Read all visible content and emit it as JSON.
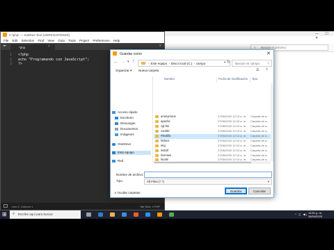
{
  "browser": {
    "window_controls": "— ☐ ✕",
    "search_placeholder": "Buscar el próximo"
  },
  "sublime": {
    "title": "C:\\php\\ — Sublime Text (UNREGISTERED)",
    "menu": [
      "File",
      "Edit",
      "Selection",
      "Find",
      "View",
      "Goto",
      "Tools",
      "Project",
      "Preferences",
      "Help"
    ],
    "tab_label": "*php",
    "line_numbers": "1\n2\n3",
    "code": "<?php\necho \"Programando con JavaScript\";\n?>",
    "status_left": "Line 1, Column 1",
    "status_right": "Tab Size: 4     PHP"
  },
  "dialog": {
    "title": "Guardar como",
    "close_glyph": "✕",
    "path": [
      "Este equipo",
      "Disco local (C:)",
      "campo"
    ],
    "search_placeholder": "Buscar en campo",
    "organizar_label": "Organizar ▾",
    "nueva_carpeta_label": "Nueva carpeta",
    "nav_items": [
      {
        "label": "Acceso rápido",
        "icon": "star-icon"
      },
      {
        "label": "Escritorio",
        "icon": "desktop-icon"
      },
      {
        "label": "Descargas",
        "icon": "download-icon"
      },
      {
        "label": "Documentos",
        "icon": "documents-icon"
      },
      {
        "label": "Imágenes",
        "icon": "pictures-icon"
      },
      {
        "label": "OneDrive",
        "icon": "cloud-icon"
      },
      {
        "label": "Este equipo",
        "icon": "computer-icon"
      },
      {
        "label": "Red",
        "icon": "network-icon"
      }
    ],
    "columns": [
      "Nombre",
      "Fecha de modificación",
      "Tipo"
    ],
    "files": [
      {
        "name": "anonymous",
        "date": "27/06/2020 12:13 a. m.",
        "type": "Carpeta de a..."
      },
      {
        "name": "apache",
        "date": "27/06/2020 12:15 a. m.",
        "type": "Carpeta de a..."
      },
      {
        "name": "cgi-bin",
        "date": "27/06/2020 12:13 a. m.",
        "type": "Carpeta de a..."
      },
      {
        "name": "contrib",
        "date": "27/06/2020 12:13 a. m.",
        "type": "Carpeta de a..."
      },
      {
        "name": "FileZilla",
        "date": "27/06/2020 12:13 a. m.",
        "type": "Carpeta de a..."
      },
      {
        "name": "htdocs",
        "date": "27/06/2020 12:13 a. m.",
        "type": "Carpeta de a..."
      },
      {
        "name": "img",
        "date": "27/06/2020 12:13 a. m.",
        "type": "Carpeta de a..."
      },
      {
        "name": "install",
        "date": "27/06/2020 12:13 a. m.",
        "type": "Carpeta de a..."
      },
      {
        "name": "licenses",
        "date": "27/06/2020 12:13 a. m.",
        "type": "Carpeta de a..."
      },
      {
        "name": "locale",
        "date": "27/06/2020 12:13 a. m.",
        "type": "Carpeta de a..."
      }
    ],
    "nombre_label": "Nombre de archivo:",
    "nombre_value": "",
    "tipo_label": "Tipo:",
    "tipo_value": "All Files (*.*)",
    "ocultar_label": "∧  Ocultar carpetas",
    "guardar_label": "Guardar",
    "cancelar_label": "Cancelar"
  },
  "taskbar": {
    "search_placeholder": "Escribe aquí para buscar",
    "tray": "^ ◻ ◀)",
    "time": "12:51 p. m.",
    "date": "26/04/2020"
  }
}
